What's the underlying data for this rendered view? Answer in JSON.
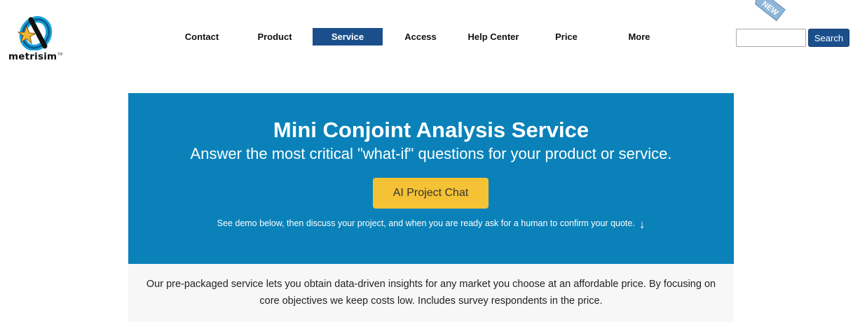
{
  "brand": {
    "name": "metrisim",
    "tm": "TM"
  },
  "nav": {
    "items": [
      {
        "label": "Contact"
      },
      {
        "label": "Product"
      },
      {
        "label": "Service",
        "active": true
      },
      {
        "label": "Access"
      },
      {
        "label": "Help Center"
      },
      {
        "label": "Price"
      },
      {
        "label": "More"
      }
    ]
  },
  "badge": {
    "label": "NEW"
  },
  "search": {
    "value": "",
    "placeholder": "",
    "button_label": "Search"
  },
  "hero": {
    "title": "Mini Conjoint Analysis Service",
    "subtitle": "Answer the most critical \"what-if\" questions for your product or service.",
    "cta_label": "AI Project Chat",
    "note": "See demo below, then discuss your project, and when you are ready ask for a human to confirm your quote.",
    "note_arrow": "↓"
  },
  "intro": {
    "text": "Our pre-packaged service lets you obtain data-driven insights for any market you choose at an affordable price. By focusing on core objectives we keep costs low. Includes survey respondents in the price."
  },
  "colors": {
    "nav_active": "#1b4f8c",
    "hero_bg": "#0a82b9",
    "cta_bg": "#f4c234",
    "intro_bg": "#f7f7f7"
  }
}
